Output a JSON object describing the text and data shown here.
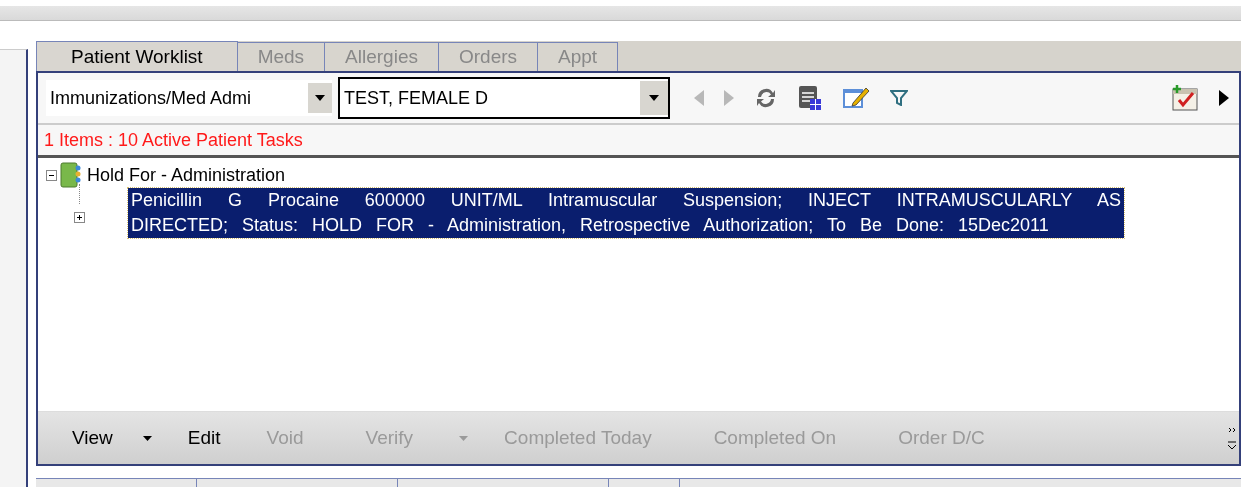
{
  "tabs": [
    {
      "label": "Patient Worklist",
      "selected": true
    },
    {
      "label": "Meds",
      "selected": false
    },
    {
      "label": "Allergies",
      "selected": false
    },
    {
      "label": "Orders",
      "selected": false
    },
    {
      "label": "Appt",
      "selected": false
    }
  ],
  "worklist_select": {
    "value": "Immunizations/Med Admi"
  },
  "patient_select": {
    "value": "TEST, FEMALE D"
  },
  "status_text": "1 Items : 10 Active Patient Tasks",
  "tree": [
    {
      "label": "Hold For - Administration",
      "expanded": true,
      "children": [
        {
          "label": "Penicillin G Procaine 600000 UNIT/ML Intramuscular Suspension; INJECT INTRAMUSCULARLY AS DIRECTED; Status: HOLD FOR - Administration, Retrospective Authorization; To Be Done: 15Dec2011",
          "selected": true,
          "expanded": false
        }
      ]
    }
  ],
  "actions": [
    {
      "label": "View",
      "disabled": false,
      "has_menu": true
    },
    {
      "label": "Edit",
      "disabled": false,
      "has_menu": false
    },
    {
      "label": "Void",
      "disabled": true,
      "has_menu": false
    },
    {
      "label": "Verify",
      "disabled": true,
      "has_menu": true
    },
    {
      "label": "Completed Today",
      "disabled": true,
      "has_menu": false
    },
    {
      "label": "Completed On",
      "disabled": true,
      "has_menu": false
    },
    {
      "label": "Order D/C",
      "disabled": true,
      "has_menu": false
    }
  ]
}
